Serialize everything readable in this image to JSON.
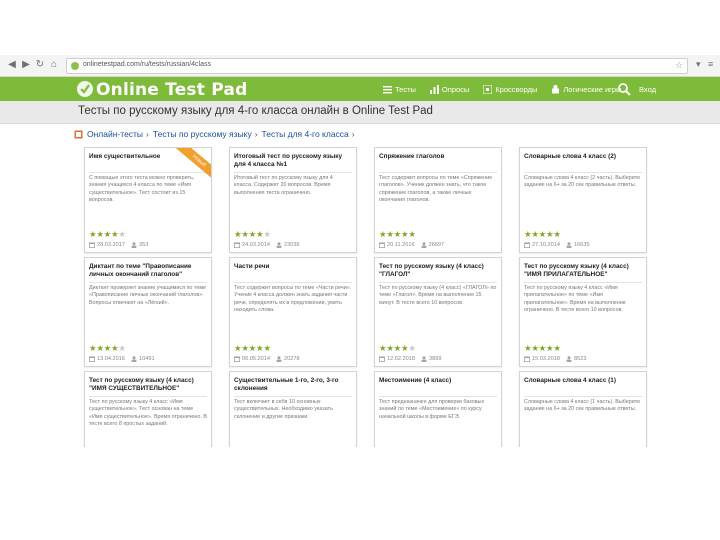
{
  "browser": {
    "url": "onlinetestpad.com/ru/tests/russian/4class"
  },
  "header": {
    "logo_text": "Online Test Pad",
    "nav": [
      {
        "label": "Тесты",
        "icon": "list-icon"
      },
      {
        "label": "Опросы",
        "icon": "poll-icon"
      },
      {
        "label": "Кроссворды",
        "icon": "crossword-icon"
      },
      {
        "label": "Логические игры",
        "icon": "puzzle-icon"
      }
    ],
    "login": "Вход"
  },
  "page": {
    "title": "Тесты по русскому языку для 4-го класса онлайн в Online Test Pad",
    "breadcrumbs": [
      "Онлайн-тесты",
      "Тесты по русскому языку",
      "Тесты для 4-го класса"
    ],
    "crumb_sep": "›"
  },
  "colors": {
    "brand": "#7fbb3b",
    "link": "#1d4fa1",
    "stars": "#7fa827",
    "ribbon": "#f0a030"
  },
  "cards": [
    {
      "title": "Имя существительное",
      "desc": "С помощью этого теста можно проверить, знания учащихся 4 класса по теме «Имя существительное». Тест состоит из 15 вопросов.",
      "rating": 4,
      "date": "28.03.2017",
      "count": "353",
      "ribbon": "Новый"
    },
    {
      "title": "Итоговый тест по русскому языку для 4 класса №1",
      "desc": "Итоговый тест по русскому языку для 4 класса. Содержит 20 вопросов. Время выполнения теста ограничено.",
      "rating": 4,
      "date": "24.03.2014",
      "count": "23036"
    },
    {
      "title": "Спряжение глаголов",
      "desc": "Тест содержит вопросы по теме «Спряжение глаголов». Ученик должен знать, что такое спряжение глаголов, а также личные окончания глаголов.",
      "rating": 5,
      "date": "20.11.2016",
      "count": "26697"
    },
    {
      "title": "Словарные слова 4 класс (2)",
      "desc": "Словарные слова 4 класс (2 часть). Выберите задание на 6+ за 20 сек правильные ответы.",
      "rating": 5,
      "date": "27.10.2014",
      "count": "16635"
    },
    {
      "title": "Диктант по теме \"Правописание личных окончаний глаголов\"",
      "desc": "Диктант проверяет знание учащимися по теме «Правописание личных окончаний глаголов». Вопросы отвечают на «Лёгкий».",
      "rating": 4,
      "date": "13.04.2016",
      "count": "10491"
    },
    {
      "title": "Части речи",
      "desc": "Тест содержит вопросы по теме «Части речи». Ученик 4 класса должен знать задания части речи, определять их в предложении, уметь находить слова.",
      "rating": 5,
      "date": "06.05.2014",
      "count": "20278"
    },
    {
      "title": "Тест по русскому языку (4 класс) \"ГЛАГОЛ\"",
      "desc": "Тест по русскому языку (4 класс) «ГЛАГОЛ» по теме «Глагол». Время на выполнение 15 минут. В тесте всего 10 вопросов.",
      "rating": 4,
      "date": "12.02.2018",
      "count": "3899"
    },
    {
      "title": "Тест по русскому языку (4 класс) \"ИМЯ ПРИЛАГАТЕЛЬНОЕ\"",
      "desc": "Тест по русскому языку 4 класс «Имя прилагательное» по теме «Имя прилагательное». Время на выполнение ограничено. В тесте всего 10 вопросов.",
      "rating": 5,
      "date": "15.03.2018",
      "count": "8523"
    },
    {
      "title": "Тест по русскому языку (4 класс) \"ИМЯ СУЩЕСТВИТЕЛЬНОЕ\"",
      "desc": "Тест по русскому языку 4 класс «Имя существительное». Тест основан на теме «Имя существительное». Время ограничено. В тесте всего 8 простых заданий.",
      "rating": 0,
      "date": "",
      "count": ""
    },
    {
      "title": "Существительные 1-го, 2-го, 3-го склонения",
      "desc": "Тест включает в себя 10 основных существительных. Необходимо указать склонение и другие признаки.",
      "rating": 0,
      "date": "",
      "count": ""
    },
    {
      "title": "Местоимение (4 класс)",
      "desc": "Тест предназначен для проверки базовых знаний по теме «Местоимение» по курсу начальной школы в форме ЕГЭ.",
      "rating": 0,
      "date": "",
      "count": ""
    },
    {
      "title": "Словарные слова 4 класс (1)",
      "desc": "Словарные слова 4 класс (1 часть). Выберите задание на 6+ за 20 сек правильные ответы.",
      "rating": 0,
      "date": "",
      "count": ""
    }
  ]
}
